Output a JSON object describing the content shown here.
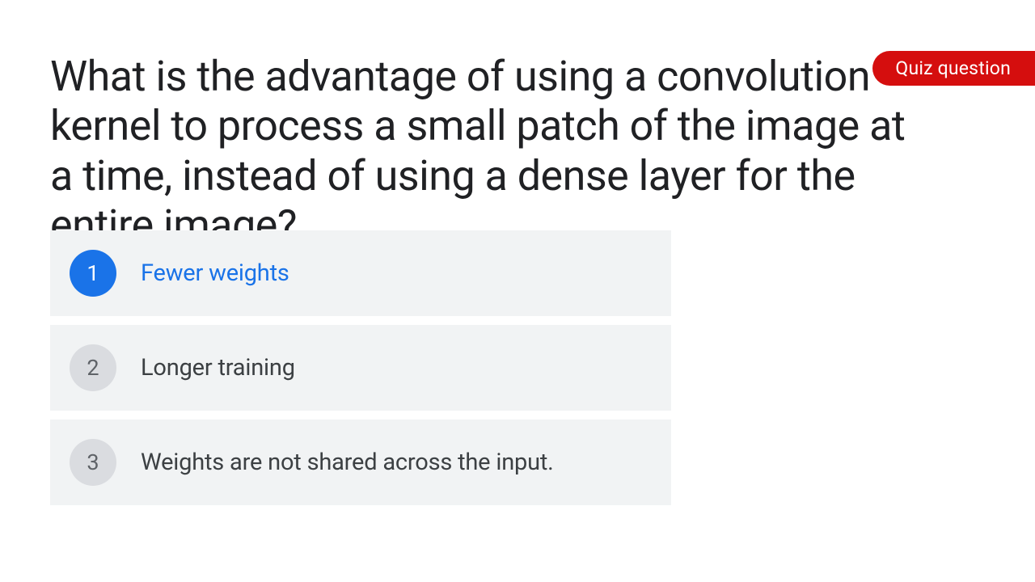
{
  "badge": {
    "label": "Quiz question"
  },
  "question": {
    "text": "What is the advantage of using a convolution kernel to process a small patch of the image at a time, instead of using a dense layer for the entire image?"
  },
  "options": [
    {
      "number": "1",
      "text": "Fewer weights",
      "selected": true
    },
    {
      "number": "2",
      "text": "Longer training",
      "selected": false
    },
    {
      "number": "3",
      "text": "Weights are not shared across the input.",
      "selected": false
    }
  ]
}
